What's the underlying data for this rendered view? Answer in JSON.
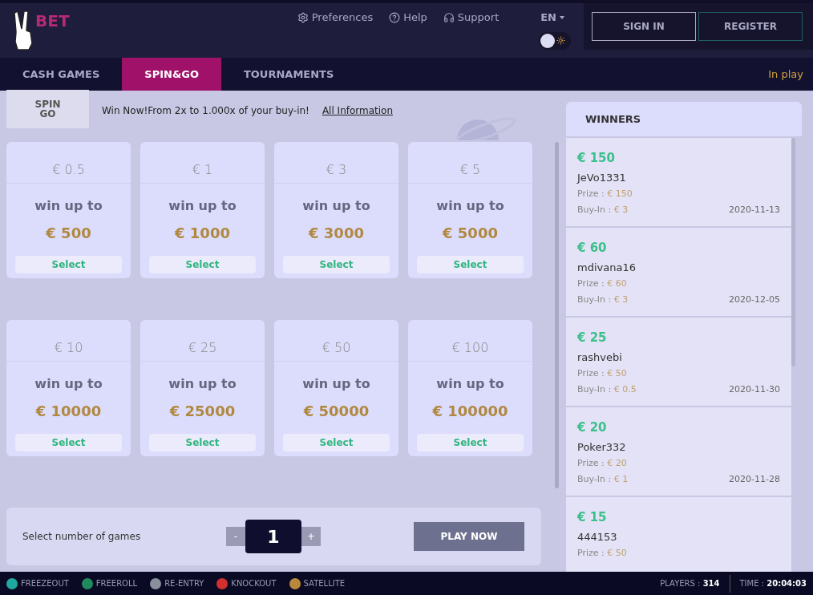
{
  "logo": {
    "text": "BET"
  },
  "top_links": [
    {
      "kind": "gear",
      "label": "Preferences"
    },
    {
      "kind": "help",
      "label": "Help"
    },
    {
      "kind": "headset",
      "label": "Support"
    }
  ],
  "language": {
    "label": "EN"
  },
  "theme_toggle": {
    "on": false
  },
  "auth_buttons": [
    {
      "label": "SIGN IN",
      "kind": "signin"
    },
    {
      "label": "REGISTER",
      "kind": "register"
    }
  ],
  "tabs": [
    {
      "label": "CASH GAMES",
      "selected": false
    },
    {
      "label": "SPIN&GO",
      "selected": true
    },
    {
      "label": "TOURNAMENTS",
      "selected": false
    }
  ],
  "in_play": "In play",
  "promo": {
    "logo_lines": [
      "SPIN",
      "GO"
    ],
    "text": "Win Now!From 2x to 1.000x of your buy-in!",
    "link": "All Information"
  },
  "cards": [
    {
      "buy_in": "€ 0.5",
      "caption": "win up to",
      "prize": "€ 500",
      "button": "Select"
    },
    {
      "buy_in": "€ 1",
      "caption": "win up to",
      "prize": "€ 1000",
      "button": "Select"
    },
    {
      "buy_in": "€ 3",
      "caption": "win up to",
      "prize": "€ 3000",
      "button": "Select"
    },
    {
      "buy_in": "€ 5",
      "caption": "win up to",
      "prize": "€ 5000",
      "button": "Select"
    },
    {
      "buy_in": "€ 10",
      "caption": "win up to",
      "prize": "€ 10000",
      "button": "Select"
    },
    {
      "buy_in": "€ 25",
      "caption": "win up to",
      "prize": "€ 25000",
      "button": "Select"
    },
    {
      "buy_in": "€ 50",
      "caption": "win up to",
      "prize": "€ 50000",
      "button": "Select"
    },
    {
      "buy_in": "€ 100",
      "caption": "win up to",
      "prize": "€ 100000",
      "button": "Select"
    }
  ],
  "games_bar": {
    "label": "Select number of games",
    "minus": "-",
    "count": "1",
    "plus": "+",
    "play": "PLAY NOW"
  },
  "winners": {
    "title": "WINNERS",
    "entries": [
      {
        "amount": "€ 150",
        "name": "JeVo1331",
        "prize_label": "Prize :",
        "prize": "€ 150",
        "buyin_label": "Buy-In :",
        "buyin": "€ 3",
        "date": "2020-11-13"
      },
      {
        "amount": "€ 60",
        "name": "mdivana16",
        "prize_label": "Prize :",
        "prize": "€ 60",
        "buyin_label": "Buy-In :",
        "buyin": "€ 3",
        "date": "2020-12-05"
      },
      {
        "amount": "€ 25",
        "name": "rashvebi",
        "prize_label": "Prize :",
        "prize": "€ 50",
        "buyin_label": "Buy-In :",
        "buyin": "€ 0.5",
        "date": "2020-11-30"
      },
      {
        "amount": "€ 20",
        "name": "Poker332",
        "prize_label": "Prize :",
        "prize": "€ 20",
        "buyin_label": "Buy-In :",
        "buyin": "€ 1",
        "date": "2020-11-28"
      },
      {
        "amount": "€ 15",
        "name": "444153",
        "prize_label": "Prize :",
        "prize": "€ 50"
      }
    ]
  },
  "legend": [
    {
      "label": "FREEZEOUT",
      "color": "#1fa9a0"
    },
    {
      "label": "FREEROLL",
      "color": "#1f8a5c"
    },
    {
      "label": "RE-ENTRY",
      "color": "#8a8f9c"
    },
    {
      "label": "KNOCKOUT",
      "color": "#d2302f"
    },
    {
      "label": "SATELLITE",
      "color": "#b8893a"
    }
  ],
  "status": {
    "players_label": "PLAYERS :",
    "players": "314",
    "time_label": "TIME :",
    "time": "20:04:03"
  }
}
